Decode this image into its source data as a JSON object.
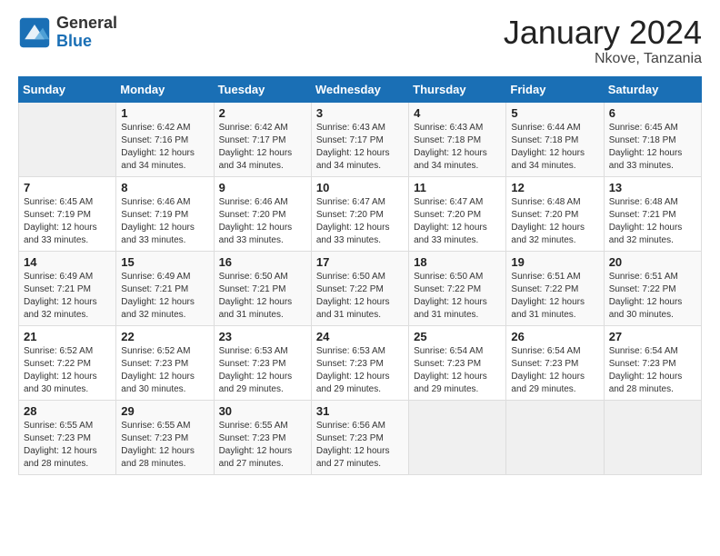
{
  "header": {
    "logo_general": "General",
    "logo_blue": "Blue",
    "month_title": "January 2024",
    "location": "Nkove, Tanzania"
  },
  "weekdays": [
    "Sunday",
    "Monday",
    "Tuesday",
    "Wednesday",
    "Thursday",
    "Friday",
    "Saturday"
  ],
  "weeks": [
    [
      {
        "day": "",
        "sunrise": "",
        "sunset": "",
        "daylight": ""
      },
      {
        "day": "1",
        "sunrise": "Sunrise: 6:42 AM",
        "sunset": "Sunset: 7:16 PM",
        "daylight": "Daylight: 12 hours and 34 minutes."
      },
      {
        "day": "2",
        "sunrise": "Sunrise: 6:42 AM",
        "sunset": "Sunset: 7:17 PM",
        "daylight": "Daylight: 12 hours and 34 minutes."
      },
      {
        "day": "3",
        "sunrise": "Sunrise: 6:43 AM",
        "sunset": "Sunset: 7:17 PM",
        "daylight": "Daylight: 12 hours and 34 minutes."
      },
      {
        "day": "4",
        "sunrise": "Sunrise: 6:43 AM",
        "sunset": "Sunset: 7:18 PM",
        "daylight": "Daylight: 12 hours and 34 minutes."
      },
      {
        "day": "5",
        "sunrise": "Sunrise: 6:44 AM",
        "sunset": "Sunset: 7:18 PM",
        "daylight": "Daylight: 12 hours and 34 minutes."
      },
      {
        "day": "6",
        "sunrise": "Sunrise: 6:45 AM",
        "sunset": "Sunset: 7:18 PM",
        "daylight": "Daylight: 12 hours and 33 minutes."
      }
    ],
    [
      {
        "day": "7",
        "sunrise": "Sunrise: 6:45 AM",
        "sunset": "Sunset: 7:19 PM",
        "daylight": "Daylight: 12 hours and 33 minutes."
      },
      {
        "day": "8",
        "sunrise": "Sunrise: 6:46 AM",
        "sunset": "Sunset: 7:19 PM",
        "daylight": "Daylight: 12 hours and 33 minutes."
      },
      {
        "day": "9",
        "sunrise": "Sunrise: 6:46 AM",
        "sunset": "Sunset: 7:20 PM",
        "daylight": "Daylight: 12 hours and 33 minutes."
      },
      {
        "day": "10",
        "sunrise": "Sunrise: 6:47 AM",
        "sunset": "Sunset: 7:20 PM",
        "daylight": "Daylight: 12 hours and 33 minutes."
      },
      {
        "day": "11",
        "sunrise": "Sunrise: 6:47 AM",
        "sunset": "Sunset: 7:20 PM",
        "daylight": "Daylight: 12 hours and 33 minutes."
      },
      {
        "day": "12",
        "sunrise": "Sunrise: 6:48 AM",
        "sunset": "Sunset: 7:20 PM",
        "daylight": "Daylight: 12 hours and 32 minutes."
      },
      {
        "day": "13",
        "sunrise": "Sunrise: 6:48 AM",
        "sunset": "Sunset: 7:21 PM",
        "daylight": "Daylight: 12 hours and 32 minutes."
      }
    ],
    [
      {
        "day": "14",
        "sunrise": "Sunrise: 6:49 AM",
        "sunset": "Sunset: 7:21 PM",
        "daylight": "Daylight: 12 hours and 32 minutes."
      },
      {
        "day": "15",
        "sunrise": "Sunrise: 6:49 AM",
        "sunset": "Sunset: 7:21 PM",
        "daylight": "Daylight: 12 hours and 32 minutes."
      },
      {
        "day": "16",
        "sunrise": "Sunrise: 6:50 AM",
        "sunset": "Sunset: 7:21 PM",
        "daylight": "Daylight: 12 hours and 31 minutes."
      },
      {
        "day": "17",
        "sunrise": "Sunrise: 6:50 AM",
        "sunset": "Sunset: 7:22 PM",
        "daylight": "Daylight: 12 hours and 31 minutes."
      },
      {
        "day": "18",
        "sunrise": "Sunrise: 6:50 AM",
        "sunset": "Sunset: 7:22 PM",
        "daylight": "Daylight: 12 hours and 31 minutes."
      },
      {
        "day": "19",
        "sunrise": "Sunrise: 6:51 AM",
        "sunset": "Sunset: 7:22 PM",
        "daylight": "Daylight: 12 hours and 31 minutes."
      },
      {
        "day": "20",
        "sunrise": "Sunrise: 6:51 AM",
        "sunset": "Sunset: 7:22 PM",
        "daylight": "Daylight: 12 hours and 30 minutes."
      }
    ],
    [
      {
        "day": "21",
        "sunrise": "Sunrise: 6:52 AM",
        "sunset": "Sunset: 7:22 PM",
        "daylight": "Daylight: 12 hours and 30 minutes."
      },
      {
        "day": "22",
        "sunrise": "Sunrise: 6:52 AM",
        "sunset": "Sunset: 7:23 PM",
        "daylight": "Daylight: 12 hours and 30 minutes."
      },
      {
        "day": "23",
        "sunrise": "Sunrise: 6:53 AM",
        "sunset": "Sunset: 7:23 PM",
        "daylight": "Daylight: 12 hours and 29 minutes."
      },
      {
        "day": "24",
        "sunrise": "Sunrise: 6:53 AM",
        "sunset": "Sunset: 7:23 PM",
        "daylight": "Daylight: 12 hours and 29 minutes."
      },
      {
        "day": "25",
        "sunrise": "Sunrise: 6:54 AM",
        "sunset": "Sunset: 7:23 PM",
        "daylight": "Daylight: 12 hours and 29 minutes."
      },
      {
        "day": "26",
        "sunrise": "Sunrise: 6:54 AM",
        "sunset": "Sunset: 7:23 PM",
        "daylight": "Daylight: 12 hours and 29 minutes."
      },
      {
        "day": "27",
        "sunrise": "Sunrise: 6:54 AM",
        "sunset": "Sunset: 7:23 PM",
        "daylight": "Daylight: 12 hours and 28 minutes."
      }
    ],
    [
      {
        "day": "28",
        "sunrise": "Sunrise: 6:55 AM",
        "sunset": "Sunset: 7:23 PM",
        "daylight": "Daylight: 12 hours and 28 minutes."
      },
      {
        "day": "29",
        "sunrise": "Sunrise: 6:55 AM",
        "sunset": "Sunset: 7:23 PM",
        "daylight": "Daylight: 12 hours and 28 minutes."
      },
      {
        "day": "30",
        "sunrise": "Sunrise: 6:55 AM",
        "sunset": "Sunset: 7:23 PM",
        "daylight": "Daylight: 12 hours and 27 minutes."
      },
      {
        "day": "31",
        "sunrise": "Sunrise: 6:56 AM",
        "sunset": "Sunset: 7:23 PM",
        "daylight": "Daylight: 12 hours and 27 minutes."
      },
      {
        "day": "",
        "sunrise": "",
        "sunset": "",
        "daylight": ""
      },
      {
        "day": "",
        "sunrise": "",
        "sunset": "",
        "daylight": ""
      },
      {
        "day": "",
        "sunrise": "",
        "sunset": "",
        "daylight": ""
      }
    ]
  ]
}
